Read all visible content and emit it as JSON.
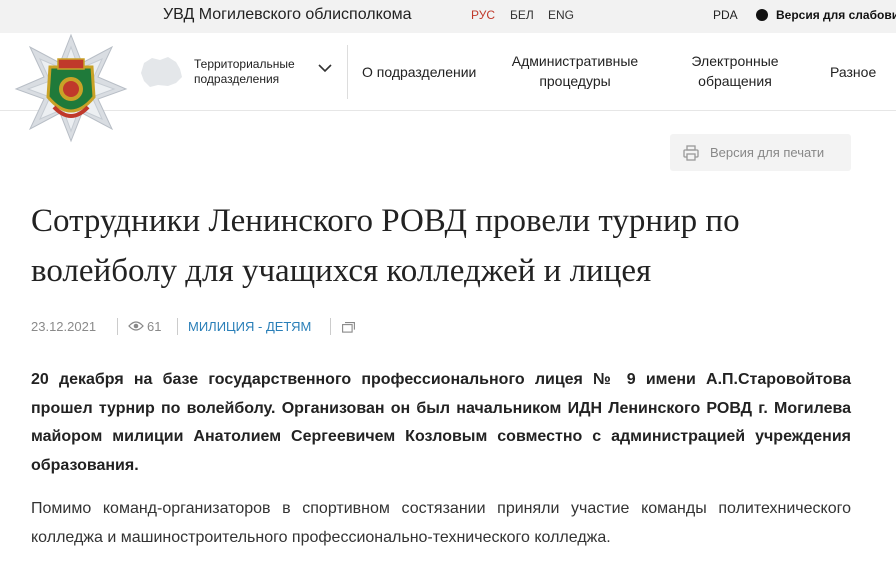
{
  "topbar": {
    "org_name": "УВД Могилевского облисполкома",
    "languages": [
      "РУС",
      "БЕЛ",
      "ENG"
    ],
    "active_language": "РУС",
    "pda": "PDA",
    "low_vision": "Версия для слабовидящих"
  },
  "header": {
    "territorial": "Территориальные подразделения",
    "nav": [
      "О подразделении",
      "Административные процедуры",
      "Электронные обращения",
      "Разное"
    ]
  },
  "print_label": "Версия для печати",
  "article": {
    "title": "Сотрудники Ленинского РОВД провели турнир по волейболу для учащихся колледжей и лицея",
    "date": "23.12.2021",
    "views": "61",
    "category": "МИЛИЦИЯ - ДЕТЯМ",
    "lead": "20 декабря на базе государственного профессионального лицея № 9 имени А.П.Старовойтова прошел турнир по волейболу. Организован он был начальником ИДН Ленинского РОВД г. Могилева майором милиции Анатолием Сергеевичем Козловым совместно с администрацией учреждения образования.",
    "paragraph": "Помимо команд-организаторов в спортивном состязании приняли участие команды политехнического колледжа и машиностроительного профессионально-технического колледжа."
  },
  "colors": {
    "accent_red": "#c0392b",
    "link_blue": "#2a7fb8",
    "topbar_bg": "#f2f2f2"
  },
  "icons": [
    "print-icon",
    "eye-icon",
    "copy-icon",
    "chevron-down-icon",
    "belarus-map-icon",
    "emblem-logo"
  ]
}
